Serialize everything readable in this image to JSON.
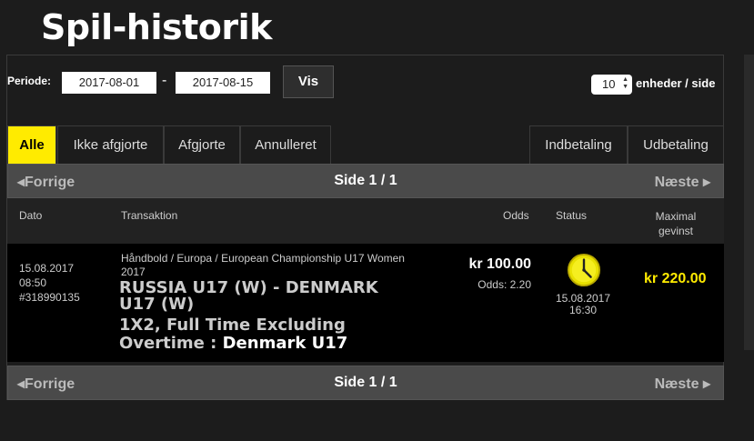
{
  "page": {
    "title": "Spil-historik"
  },
  "filter": {
    "period_label": "Periode:",
    "from_date": "2017-08-01",
    "separator": "-",
    "to_date": "2017-08-15",
    "submit_label": "Vis",
    "per_page_value": "10",
    "per_page_label": "enheder / side"
  },
  "tabs": [
    {
      "label": "Alle",
      "active": true
    },
    {
      "label": "Ikke afgjorte"
    },
    {
      "label": "Afgjorte"
    },
    {
      "label": "Annulleret"
    },
    {
      "label": "Indbetaling"
    },
    {
      "label": "Udbetaling"
    }
  ],
  "pager": {
    "prev_label": "Forrige",
    "page_label": "Side 1 / 1",
    "next_label": "Næste"
  },
  "columns": {
    "date": "Dato",
    "transaction": "Transaktion",
    "odds": "Odds",
    "status": "Status",
    "max_win": "Maximal gevinst"
  },
  "rows": [
    {
      "date": "15.08.2017",
      "time": "08:50",
      "id": "#318990135",
      "category": "Håndbold / Europa / European Championship U17 Women 2017",
      "match": "RUSSIA U17 (W) - DENMARK U17 (W)",
      "market": "1X2, Full Time Excluding Overtime :",
      "selection": "Denmark U17",
      "stake": "kr 100.00",
      "odds": "Odds: 2.20",
      "status_icon": "clock-icon",
      "status_date": "15.08.2017",
      "status_time": "16:30",
      "max_win": "kr 220.00"
    }
  ],
  "colors": {
    "accent": "#ffeb00",
    "background": "#1c1c1c",
    "row_bg": "#000000",
    "pager_bg": "#4a4a4a"
  }
}
